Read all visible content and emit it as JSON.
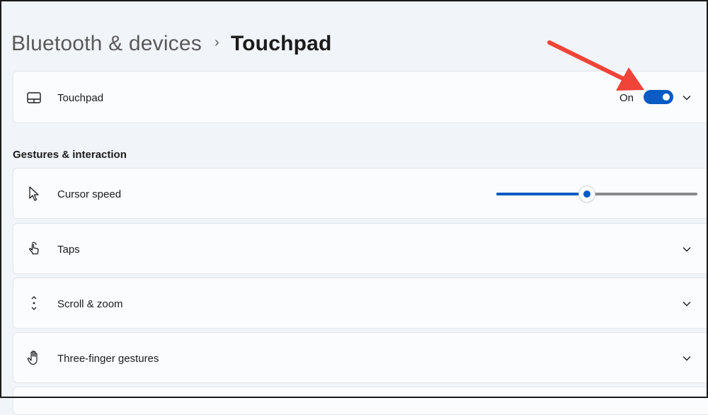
{
  "breadcrumb": {
    "parent": "Bluetooth & devices",
    "separator": "›",
    "current": "Touchpad"
  },
  "touchpad_card": {
    "icon": "touchpad-icon",
    "label": "Touchpad",
    "toggle_state_label": "On",
    "toggle_on": true
  },
  "section": {
    "title": "Gestures & interaction"
  },
  "rows": [
    {
      "icon": "cursor-icon",
      "label": "Cursor speed",
      "slider_value_fraction": 0.45
    },
    {
      "icon": "tap-hand-icon",
      "label": "Taps"
    },
    {
      "icon": "scroll-arrows-icon",
      "label": "Scroll & zoom"
    },
    {
      "icon": "hand-icon",
      "label": "Three-finger gestures"
    }
  ],
  "colors": {
    "accent": "#0a5bc4",
    "background": "#f1f4f9",
    "card": "#fbfcfe",
    "annotation_arrow": "#f04438"
  }
}
